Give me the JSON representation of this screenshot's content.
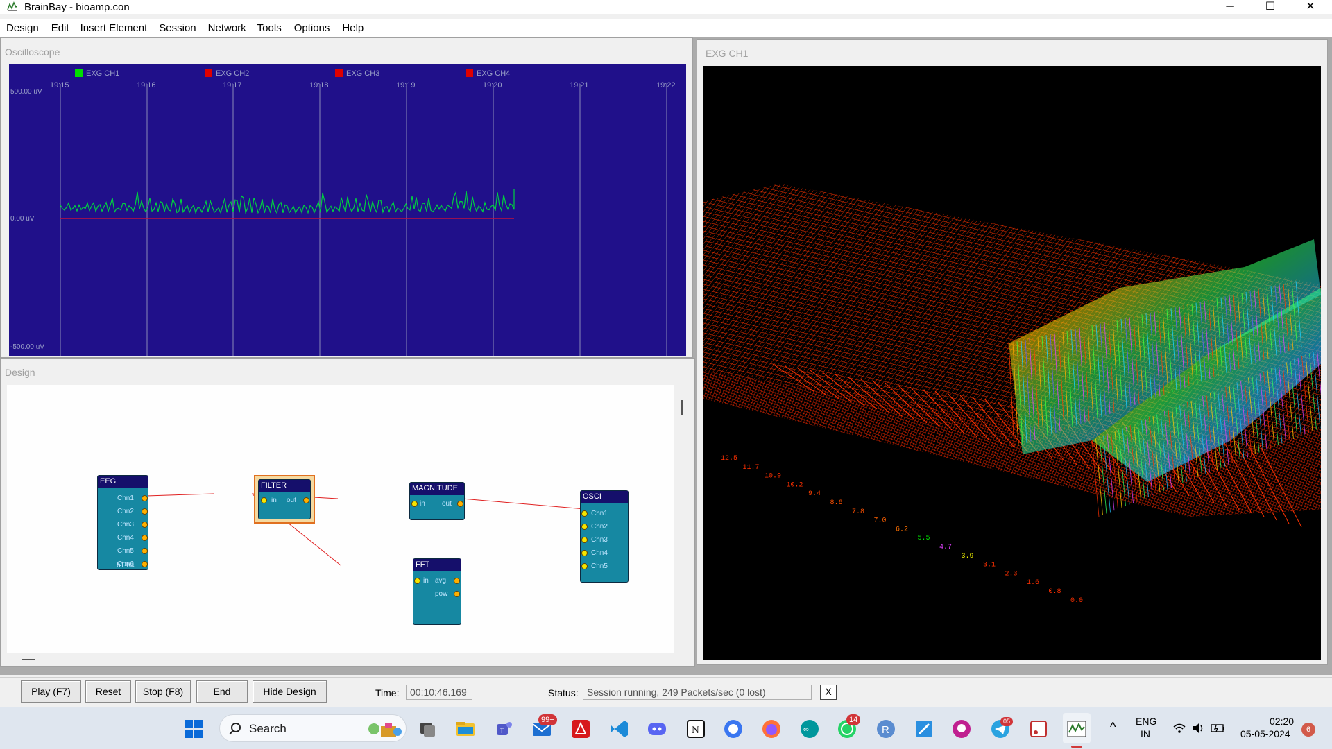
{
  "window": {
    "title": "BrainBay - bioamp.con",
    "minimize_icon": "minimize-icon",
    "maximize_icon": "maximize-icon",
    "close_icon": "close-icon",
    "min_glyph": "─",
    "max_glyph": "☐",
    "close_glyph": "✕"
  },
  "menu": [
    "Design",
    "Edit",
    "Insert Element",
    "Session",
    "Network",
    "Tools",
    "Options",
    "Help"
  ],
  "oscilloscope": {
    "caption": "Oscilloscope",
    "legend": [
      {
        "label": "EXG CH1",
        "color": "#00e000"
      },
      {
        "label": "EXG CH2",
        "color": "#e00000"
      },
      {
        "label": "EXG CH3",
        "color": "#e00000"
      },
      {
        "label": "EXG CH4",
        "color": "#e00000"
      }
    ],
    "time_ticks": [
      "19:15",
      "19:16",
      "19:17",
      "19:18",
      "19:19",
      "19:20",
      "19:21",
      "19:22"
    ],
    "y_labels": {
      "top": "500.00 uV",
      "mid": "0.00 uV",
      "bottom": "-500.00 uV"
    },
    "background_color": "#20108a",
    "trace_color": "#00d040",
    "baseline_color": "#c01040"
  },
  "exg": {
    "caption": "EXG CH1",
    "freq_labels": [
      {
        "text": "12.5",
        "color": "#ff3000"
      },
      {
        "text": "11.7",
        "color": "#ff3000"
      },
      {
        "text": "10.9",
        "color": "#ff3000"
      },
      {
        "text": "10.2",
        "color": "#ff3000"
      },
      {
        "text": "9.4",
        "color": "#ff4000"
      },
      {
        "text": "8.6",
        "color": "#ff5000"
      },
      {
        "text": "7.8",
        "color": "#ff5000"
      },
      {
        "text": "7.0",
        "color": "#ff6000"
      },
      {
        "text": "6.2",
        "color": "#ff7000"
      },
      {
        "text": "5.5",
        "color": "#00e000"
      },
      {
        "text": "4.7",
        "color": "#e040ff"
      },
      {
        "text": "3.9",
        "color": "#f0f000"
      },
      {
        "text": "3.1",
        "color": "#ff3000"
      },
      {
        "text": "2.3",
        "color": "#ff3000"
      },
      {
        "text": "1.6",
        "color": "#ff3000"
      },
      {
        "text": "0.8",
        "color": "#ff3000"
      },
      {
        "text": "0.0",
        "color": "#ff3000"
      }
    ]
  },
  "design": {
    "caption": "Design",
    "blocks": {
      "eeg": {
        "title": "EEG",
        "ports": [
          "Chn1",
          "Chn2",
          "Chn3",
          "Chn4",
          "Chn5",
          "Chn6",
          "b1-b4"
        ]
      },
      "filter": {
        "title": "FILTER",
        "in": "in",
        "out": "out"
      },
      "magnitude": {
        "title": "MAGNITUDE",
        "in": "in",
        "out": "out"
      },
      "fft": {
        "title": "FFT",
        "in": "in",
        "avg": "avg",
        "pow": "pow"
      },
      "osci": {
        "title": "OSCI",
        "ports": [
          "Chn1",
          "Chn2",
          "Chn3",
          "Chn4",
          "Chn5"
        ]
      }
    },
    "wire_color": "#e02020"
  },
  "controls": {
    "play": "Play (F7)",
    "reset": "Reset",
    "stop": "Stop (F8)",
    "end": "End",
    "hide_design": "Hide Design",
    "time_label": "Time:",
    "time_value": "00:10:46.169",
    "status_label": "Status:",
    "status_value": "Session running,  249 Packets/sec (0 lost)",
    "status_close": "X"
  },
  "taskbar": {
    "search_placeholder": "Search",
    "mail_badge": "99+",
    "whatsapp_badge": "14",
    "telegram_badge": "05",
    "lang_top": "ENG",
    "lang_bottom": "IN",
    "time": "02:20",
    "date": "05-05-2024",
    "notification_badge": "6",
    "chevron_glyph": "^"
  }
}
